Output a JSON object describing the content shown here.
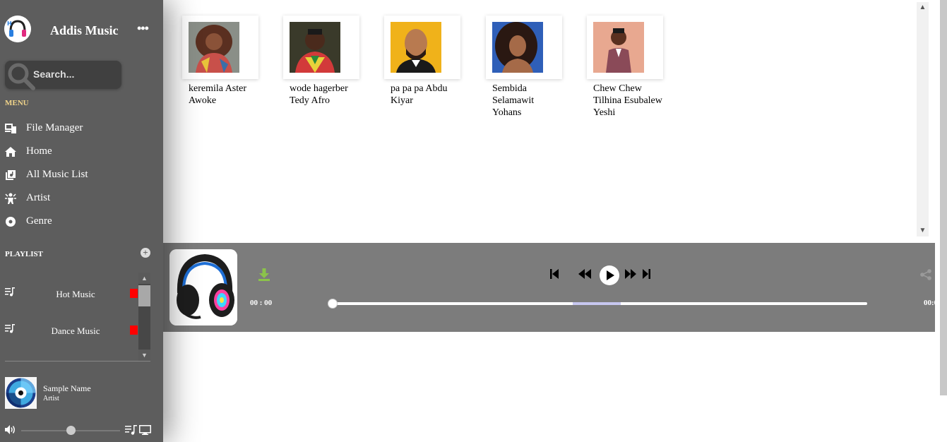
{
  "app": {
    "title": "Addis Music"
  },
  "search": {
    "placeholder": "Search..."
  },
  "menu": {
    "label": "MENU",
    "items": [
      {
        "label": "File Manager",
        "icon": "file-manager-icon"
      },
      {
        "label": "Home",
        "icon": "home-icon"
      },
      {
        "label": "All Music List",
        "icon": "music-list-icon"
      },
      {
        "label": "Artist",
        "icon": "artist-icon"
      },
      {
        "label": "Genre",
        "icon": "genre-icon"
      }
    ]
  },
  "playlist": {
    "label": "PLAYLIST",
    "items": [
      {
        "name": "Hot Music"
      },
      {
        "name": "Dance Music"
      }
    ]
  },
  "now_playing": {
    "name": "Sample Name",
    "artist": "Artist",
    "volume_fraction": 0.5
  },
  "artists": [
    {
      "name": "keremila Aster Awoke"
    },
    {
      "name": "wode hagerber Tedy Afro"
    },
    {
      "name": "pa pa pa Abdu Kiyar"
    },
    {
      "name": "Sembida Selamawit Yohans"
    },
    {
      "name": "Chew Chew Tilhina Esubalew Yeshi"
    }
  ],
  "player": {
    "current_time": "00 : 00",
    "end_time": "00:0",
    "progress_fraction": 0,
    "buffered_start_fraction": 0.45,
    "buffered_end_fraction": 0.54
  },
  "colors": {
    "sidebar": "#5d5d5d",
    "player": "#7c7c7c",
    "menu_label": "#f2d58a",
    "download": "#8bc34a",
    "playlist_marker": "#ff0000"
  }
}
